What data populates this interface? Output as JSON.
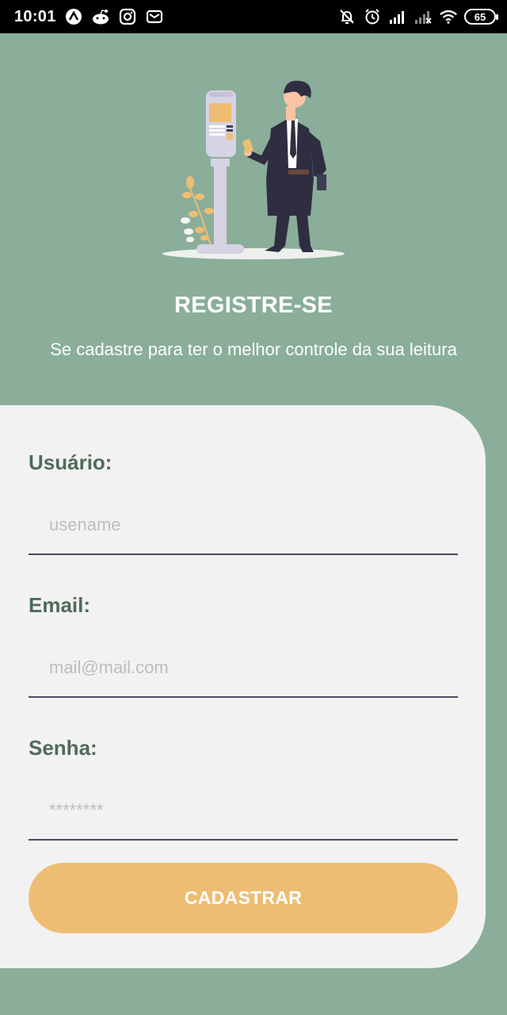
{
  "status_bar": {
    "time": "10:01",
    "battery": "65",
    "left_icons": [
      "app-icon",
      "reddit-icon",
      "instagram-icon",
      "mail-icon"
    ],
    "right_icons": [
      "notifications-off-icon",
      "alarm-icon",
      "signal-icon",
      "signal-no-data-icon",
      "wifi-icon",
      "battery-icon"
    ]
  },
  "hero": {
    "illustration": "man-at-parking-meter-illustration",
    "title": "REGISTRE-SE",
    "subtitle": "Se cadastre para ter o melhor controle da sua leitura"
  },
  "form": {
    "username": {
      "label": "Usuário:",
      "placeholder": "usename"
    },
    "email": {
      "label": "Email:",
      "placeholder": "mail@mail.com"
    },
    "password": {
      "label": "Senha:",
      "placeholder": "********"
    },
    "submit_label": "CADASTRAR"
  },
  "colors": {
    "background": "#8aae99",
    "card": "#f2f2f2",
    "label": "#4f6b5a",
    "accent": "#eebd74",
    "input_line": "#4a4a5e"
  }
}
